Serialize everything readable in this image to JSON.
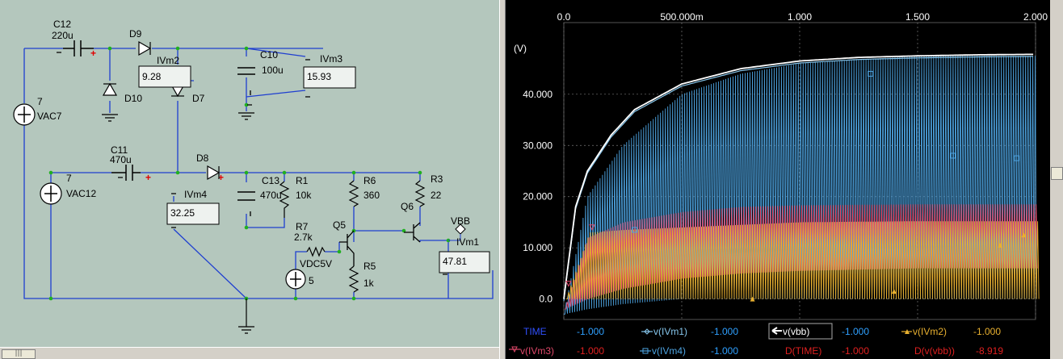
{
  "schematic": {
    "components": {
      "C12": {
        "name": "C12",
        "value": "220u"
      },
      "D9": {
        "name": "D9"
      },
      "D10": {
        "name": "D10"
      },
      "D7": {
        "name": "D7"
      },
      "C10": {
        "name": "C10",
        "value": "100u"
      },
      "VAC7": {
        "name": "VAC7",
        "value": "7"
      },
      "C11": {
        "name": "C11",
        "value": "470u"
      },
      "D8": {
        "name": "D8"
      },
      "C13": {
        "name": "C13",
        "value": "470u"
      },
      "R1": {
        "name": "R1",
        "value": "10k"
      },
      "R6": {
        "name": "R6",
        "value": "360"
      },
      "R3": {
        "name": "R3",
        "value": "22"
      },
      "VAC12": {
        "name": "VAC12",
        "value": "7"
      },
      "Q5": {
        "name": "Q5"
      },
      "Q6": {
        "name": "Q6"
      },
      "R7": {
        "name": "R7",
        "value": "2.7k"
      },
      "VDC5V": {
        "name": "VDC5V",
        "value": "5"
      },
      "R5": {
        "name": "R5",
        "value": "1k"
      },
      "VBB": {
        "name": "VBB"
      }
    },
    "meters": {
      "IVm2": {
        "name": "IVm2",
        "reading": "9.28"
      },
      "IVm3": {
        "name": "IVm3",
        "reading": "15.93"
      },
      "IVm4": {
        "name": "IVm4",
        "reading": "32.25"
      },
      "IVm1": {
        "name": "IVm1",
        "reading": "47.81"
      }
    },
    "hscroll_grip": "|||"
  },
  "colors": {
    "schematic_bg": "#b4c7bd",
    "wire": "#1f3fd0",
    "node": "#20b020",
    "plus": "#e00000",
    "vbb": "#ffffff",
    "ivm1": "#86c6ec",
    "ivm2": "#e8b030",
    "ivm3": "#e0486a",
    "ivm4": "#4da3e0",
    "time_label": "#3050ff",
    "value": "#2fa0ff",
    "dlabel": "#ff2020"
  },
  "plot": {
    "y_unit": "(V)",
    "x_ticks": [
      "0.0",
      "500.000m",
      "1.000",
      "1.500",
      "2.000"
    ],
    "y_ticks": [
      "40.000",
      "30.000",
      "20.000",
      "10.000",
      "0.0"
    ],
    "x_range": [
      0,
      2
    ],
    "y_range": [
      -4,
      54
    ]
  },
  "legend": {
    "row1": [
      {
        "label": "TIME",
        "value": "-1.000"
      },
      {
        "label": "v(IVm1)",
        "value": "-1.000"
      },
      {
        "label": "v(vbb)",
        "value": "-1.000"
      },
      {
        "label": "v(IVm2)",
        "value": "-1.000"
      }
    ],
    "row2": [
      {
        "label": "v(IVm3)",
        "value": "-1.000"
      },
      {
        "label": "v(IVm4)",
        "value": "-1.000"
      },
      {
        "label": "D(TIME)",
        "value": "-1.000"
      },
      {
        "label": "D(v(vbb))",
        "value": "-8.919"
      }
    ]
  },
  "chart_data": {
    "type": "line",
    "xlabel": "",
    "ylabel": "(V)",
    "xlim": [
      0,
      2
    ],
    "ylim": [
      -4,
      54
    ],
    "x_ticks": [
      "0.0",
      "500.000m",
      "1.000",
      "1.500",
      "2.000"
    ],
    "y_ticks": [
      "0.0",
      "10.000",
      "20.000",
      "30.000",
      "40.000"
    ],
    "series": [
      {
        "name": "v(vbb)",
        "x": [
          0.0,
          0.05,
          0.1,
          0.2,
          0.3,
          0.5,
          0.75,
          1.0,
          1.25,
          1.5,
          1.75,
          2.0
        ],
        "values": [
          0.0,
          18.0,
          25.0,
          32.0,
          37.0,
          42.0,
          45.0,
          46.5,
          47.2,
          47.5,
          47.7,
          47.8
        ]
      },
      {
        "name": "v(IVm1)",
        "x": [
          0.0,
          0.05,
          0.1,
          0.2,
          0.3,
          0.5,
          0.75,
          1.0,
          1.25,
          1.5,
          1.75,
          2.0
        ],
        "values": [
          0.0,
          18.0,
          25.0,
          32.0,
          37.0,
          42.0,
          45.0,
          46.5,
          47.2,
          47.5,
          47.7,
          47.8
        ]
      },
      {
        "name": "v(IVm4)",
        "x": [
          0.0,
          0.1,
          0.25,
          0.5,
          0.75,
          1.0,
          1.5,
          2.0
        ],
        "values": [
          -3.0,
          20.0,
          30.0,
          40.0,
          44.0,
          46.0,
          47.5,
          47.5
        ],
        "min_values": [
          -3.0,
          -2.0,
          -1.0,
          0.0,
          0.0,
          0.0,
          0.0,
          0.0
        ]
      },
      {
        "name": "v(IVm3)",
        "x": [
          0.0,
          0.1,
          0.25,
          0.5,
          0.75,
          1.0,
          1.5,
          2.0
        ],
        "values": [
          -2.0,
          12.0,
          15.0,
          17.0,
          18.0,
          18.3,
          18.5,
          18.5
        ],
        "min_values": [
          -2.0,
          0.0,
          2.0,
          4.0,
          5.0,
          5.5,
          6.0,
          6.0
        ]
      },
      {
        "name": "v(IVm2)",
        "x": [
          0.0,
          0.1,
          0.25,
          0.5,
          0.75,
          1.0,
          1.5,
          2.0
        ],
        "values": [
          0.0,
          13.0,
          13.5,
          14.0,
          14.5,
          15.0,
          15.2,
          15.2
        ],
        "min_values": [
          0.0,
          0.0,
          0.0,
          0.0,
          0.0,
          0.0,
          0.0,
          0.0
        ]
      }
    ]
  }
}
